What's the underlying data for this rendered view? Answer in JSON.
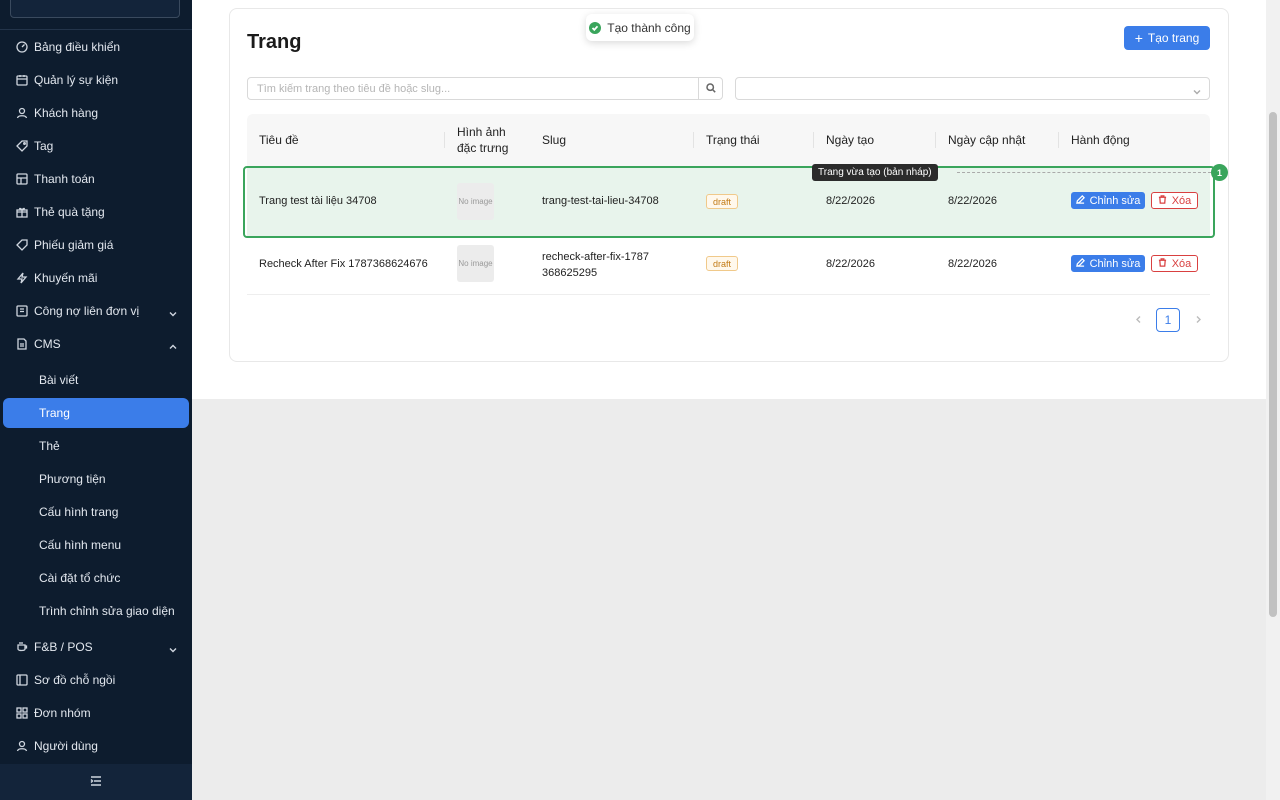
{
  "sidebar": {
    "items": [
      {
        "label": "Bảng điều khiển",
        "icon": "dashboard-icon"
      },
      {
        "label": "Quản lý sự kiện",
        "icon": "calendar-icon"
      },
      {
        "label": "Khách hàng",
        "icon": "user-icon"
      },
      {
        "label": "Tag",
        "icon": "tag-icon"
      },
      {
        "label": "Thanh toán",
        "icon": "payment-icon"
      },
      {
        "label": "Thẻ quà tặng",
        "icon": "gift-icon"
      },
      {
        "label": "Phiếu giảm giá",
        "icon": "coupon-icon"
      },
      {
        "label": "Khuyến mãi",
        "icon": "lightning-icon"
      },
      {
        "label": "Công nợ liên đơn vị",
        "icon": "ledger-icon"
      },
      {
        "label": "CMS",
        "icon": "file-icon"
      }
    ],
    "cms_children": [
      {
        "label": "Bài viết"
      },
      {
        "label": "Trang"
      },
      {
        "label": "Thẻ"
      },
      {
        "label": "Phương tiện"
      },
      {
        "label": "Cấu hình trang"
      },
      {
        "label": "Cấu hình menu"
      },
      {
        "label": "Cài đặt tổ chức"
      },
      {
        "label": "Trình chỉnh sửa giao diện"
      }
    ],
    "bottom_items": [
      {
        "label": "F&B / POS",
        "icon": "coffee-icon"
      },
      {
        "label": "Sơ đồ chỗ ngồi",
        "icon": "seat-map-icon"
      },
      {
        "label": "Đơn nhóm",
        "icon": "grid-icon"
      },
      {
        "label": "Người dùng",
        "icon": "user-icon"
      }
    ],
    "active_item": "Trang"
  },
  "page": {
    "title": "Trang",
    "create_button": "Tạo trang",
    "search_placeholder": "Tìm kiếm trang theo tiêu đề hoặc slug..."
  },
  "table": {
    "columns": [
      "Tiêu đề",
      "Hình ảnh đặc trưng",
      "Slug",
      "Trạng thái",
      "Ngày tạo",
      "Ngày cập nhật",
      "Hành động"
    ],
    "rows": [
      {
        "title": "Trang test tài liệu 34708",
        "image": "No image",
        "slug": "trang-test-tai-lieu-34708",
        "status": "draft",
        "created": "8/22/2026",
        "updated": "8/22/2026",
        "edit": "Chỉnh sửa",
        "delete": "Xóa"
      },
      {
        "title": "Recheck After Fix 1787368624676",
        "image": "No image",
        "slug": "recheck-after-fix-1787368625295",
        "status": "draft",
        "created": "8/22/2026",
        "updated": "8/22/2026",
        "edit": "Chỉnh sửa",
        "delete": "Xóa"
      }
    ]
  },
  "toast": {
    "message": "Tạo thành công",
    "color": "#3aa55c"
  },
  "annotation": {
    "tooltip": "Trang vừa tạo (bản nháp)",
    "badge": "1",
    "color": "#3aa55c"
  },
  "pagination": {
    "current": "1"
  },
  "colors": {
    "primary": "#3b7de9",
    "sidebar_bg": "#0d1c2e",
    "danger": "#d94040",
    "draft": "#c27a14"
  }
}
